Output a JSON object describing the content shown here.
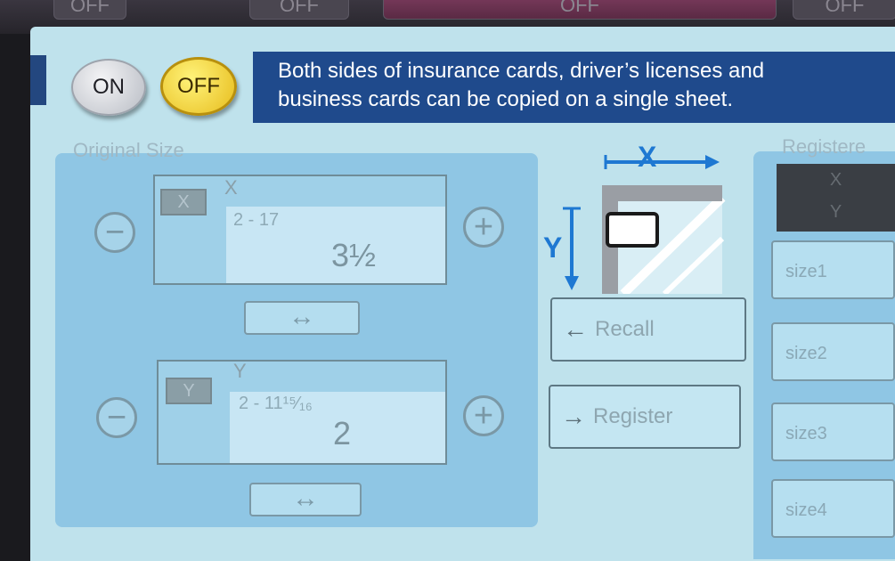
{
  "top_tabs": [
    "OFF",
    "OFF",
    "OFF",
    "OFF"
  ],
  "toggle": {
    "on_label": "ON",
    "off_label": "OFF",
    "selected": "OFF"
  },
  "banner": {
    "line1": "Both sides of insurance cards, driver’s licenses and",
    "line2": "business cards can be copied on a single sheet."
  },
  "original_size": {
    "label": "Original Size",
    "x": {
      "badge": "X",
      "letter": "X",
      "range": "2 - 17",
      "value": "3½",
      "minus": "−",
      "plus": "+",
      "swap": "↔"
    },
    "y": {
      "badge": "Y",
      "letter": "Y",
      "range": "2 - 11¹⁵⁄₁₆",
      "value": "2",
      "minus": "−",
      "plus": "+",
      "swap": "↔"
    }
  },
  "diagram": {
    "x_label": "X",
    "y_label": "Y"
  },
  "actions": {
    "recall": "Recall",
    "register": "Register",
    "recall_icon": "left-arrow-icon",
    "register_icon": "right-arrow-icon"
  },
  "registered": {
    "label": "Registere",
    "dark_x": "X",
    "dark_y": "Y",
    "sizes": [
      "size1",
      "size2",
      "size3",
      "size4"
    ]
  },
  "colors": {
    "banner": "#1f4a8c",
    "screen": "#bfe2ec",
    "panel": "#8fc6e4",
    "off_active": "#f4d23c",
    "axis_arrow": "#1e78d2"
  }
}
